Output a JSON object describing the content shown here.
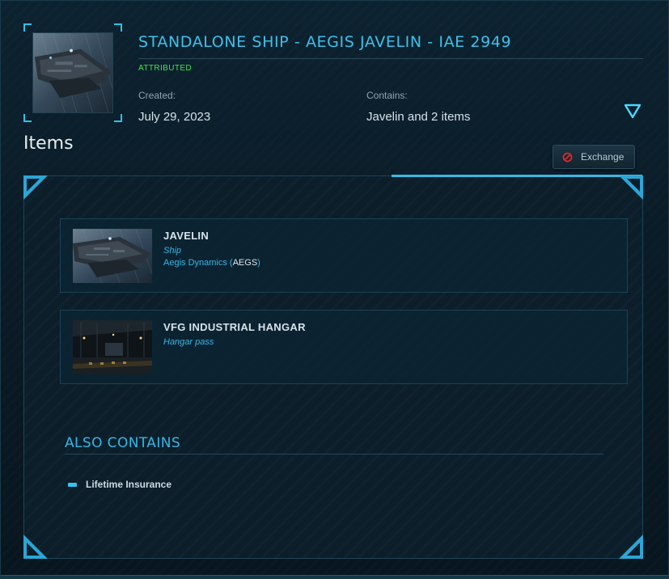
{
  "header": {
    "title": "STANDALONE SHIP - AEGIS JAVELIN - IAE 2949",
    "status": "ATTRIBUTED",
    "created_label": "Created:",
    "created_value": "July 29, 2023",
    "contains_label": "Contains:",
    "contains_value": "Javelin and 2 items",
    "expand_icon": "triangle-down-icon"
  },
  "items_section": {
    "heading": "Items",
    "exchange_label": "Exchange",
    "exchange_icon": "prohibited-icon"
  },
  "items": [
    {
      "name": "JAVELIN",
      "type": "Ship",
      "manufacturer": "Aegis Dynamics",
      "manufacturer_code": "AEGS"
    },
    {
      "name": "VFG INDUSTRIAL HANGAR",
      "type": "Hangar pass"
    }
  ],
  "also_contains": {
    "heading": "ALSO CONTAINS",
    "entries": [
      "Lifetime Insurance"
    ]
  },
  "colors": {
    "accent": "#3fc0ea",
    "status_green": "#3ee64a",
    "prohibited_red": "#e0262a"
  }
}
